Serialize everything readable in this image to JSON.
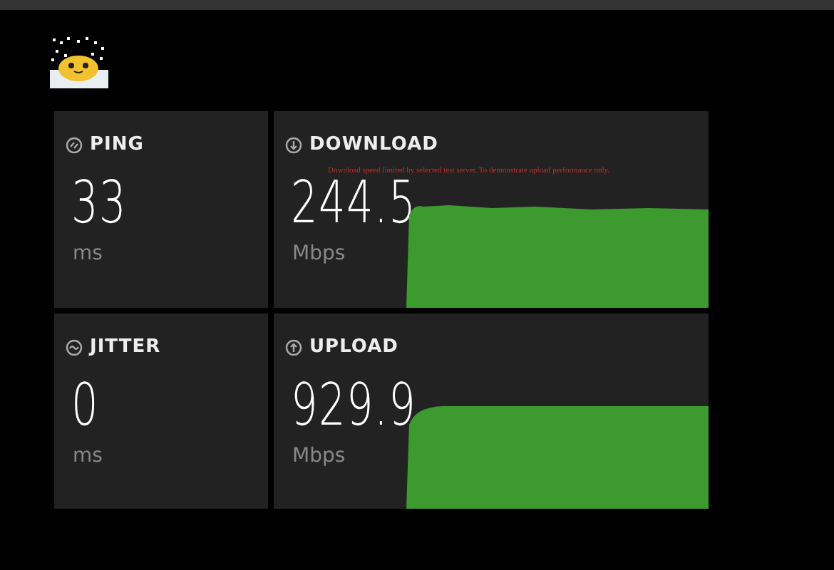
{
  "metrics": [
    {
      "kind": "small",
      "label": "PING",
      "value": "33",
      "unit": "ms"
    },
    {
      "kind": "wide",
      "label": "DOWNLOAD",
      "value": "244.5",
      "unit": "Mbps",
      "note": "Download speed limited by selected test server. To demonstrate upload performance only."
    },
    {
      "kind": "small",
      "label": "JITTER",
      "value": "0",
      "unit": "ms"
    },
    {
      "kind": "wide",
      "label": "UPLOAD",
      "value": "929.9",
      "unit": "Mbps"
    }
  ]
}
